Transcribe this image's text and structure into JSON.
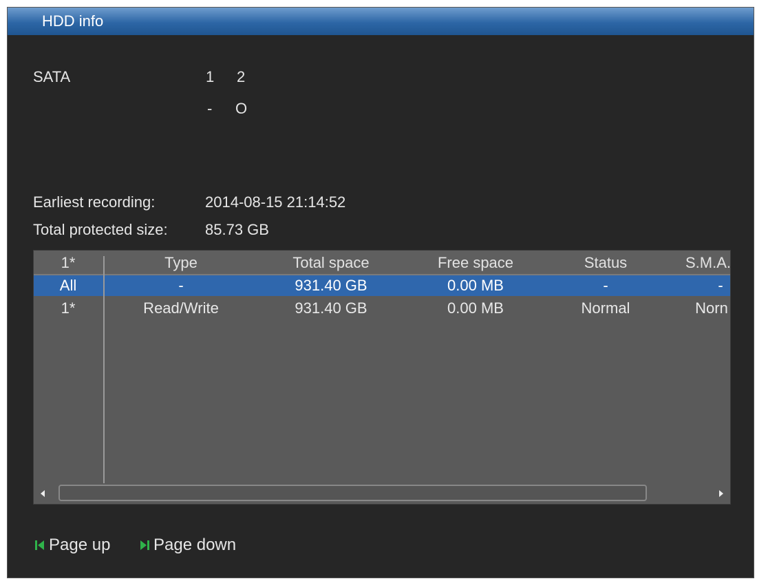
{
  "window": {
    "title": "HDD info"
  },
  "sata": {
    "label": "SATA",
    "ports": [
      {
        "number": "1",
        "state": "-"
      },
      {
        "number": "2",
        "state": "O"
      }
    ]
  },
  "info": {
    "earliest_label": "Earliest recording:",
    "earliest_value": "2014-08-15 21:14:52",
    "protected_label": "Total protected size:",
    "protected_value": "85.73 GB"
  },
  "table": {
    "headers": [
      "1*",
      "Type",
      "Total space",
      "Free space",
      "Status",
      "S.M.A."
    ],
    "rows": [
      {
        "id": "All",
        "type": "-",
        "total": "931.40 GB",
        "free": "0.00 MB",
        "status": "-",
        "smart": "-",
        "selected": true
      },
      {
        "id": "1*",
        "type": "Read/Write",
        "total": "931.40 GB",
        "free": "0.00 MB",
        "status": "Normal",
        "smart": "Norn",
        "selected": false
      }
    ]
  },
  "footer": {
    "page_up": "Page up",
    "page_down": "Page down"
  },
  "colors": {
    "title_bar": "#2d66a6",
    "selected_row": "#2f67ad",
    "pager_icon": "#2fb34a"
  }
}
